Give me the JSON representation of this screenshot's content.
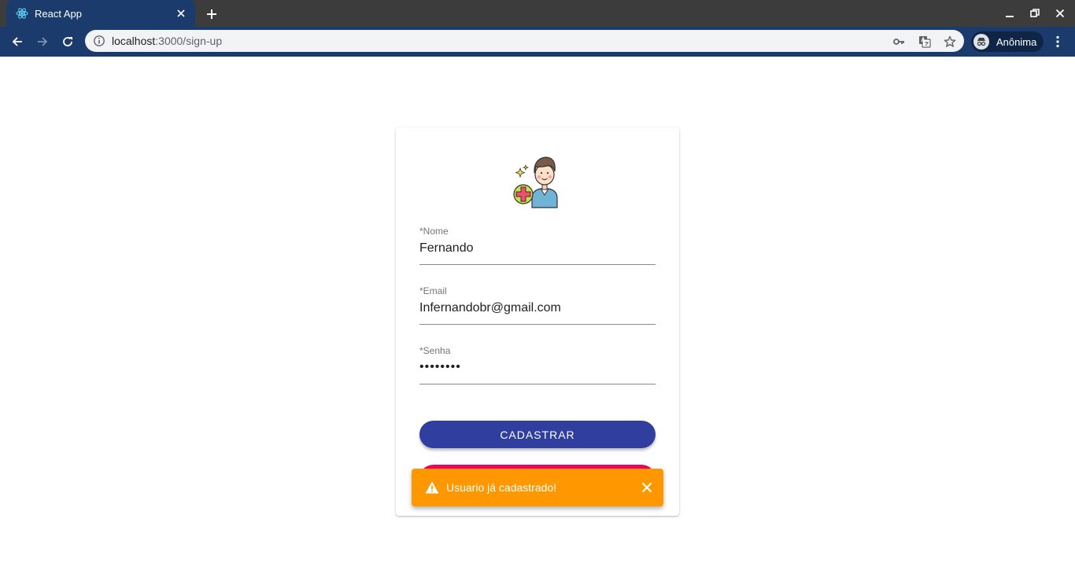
{
  "browser": {
    "tab_title": "React App",
    "url_host": "localhost",
    "url_path": ":3000/sign-up",
    "profile_name": "Anônima",
    "icons": [
      "react-favicon",
      "close-tab-icon",
      "new-tab-icon",
      "minimize-icon",
      "restore-icon",
      "close-window-icon",
      "back-icon",
      "forward-icon",
      "reload-icon",
      "info-icon",
      "key-icon",
      "translate-icon",
      "star-icon",
      "incognito-icon",
      "menu-icon"
    ]
  },
  "form": {
    "name_label": "*Nome",
    "name_value": "Fernando",
    "email_label": "*Email",
    "email_value": "Infernandobr@gmail.com",
    "password_label": "*Senha",
    "password_value": "••••••••",
    "submit_label": "CADASTRAR"
  },
  "alert": {
    "message": "Usuario já cadastrado!",
    "severity": "warning"
  },
  "colors": {
    "chrome_tab": "#1a3b6b",
    "primary": "#303f9f",
    "secondary": "#f50057",
    "warning": "#ff9800"
  }
}
